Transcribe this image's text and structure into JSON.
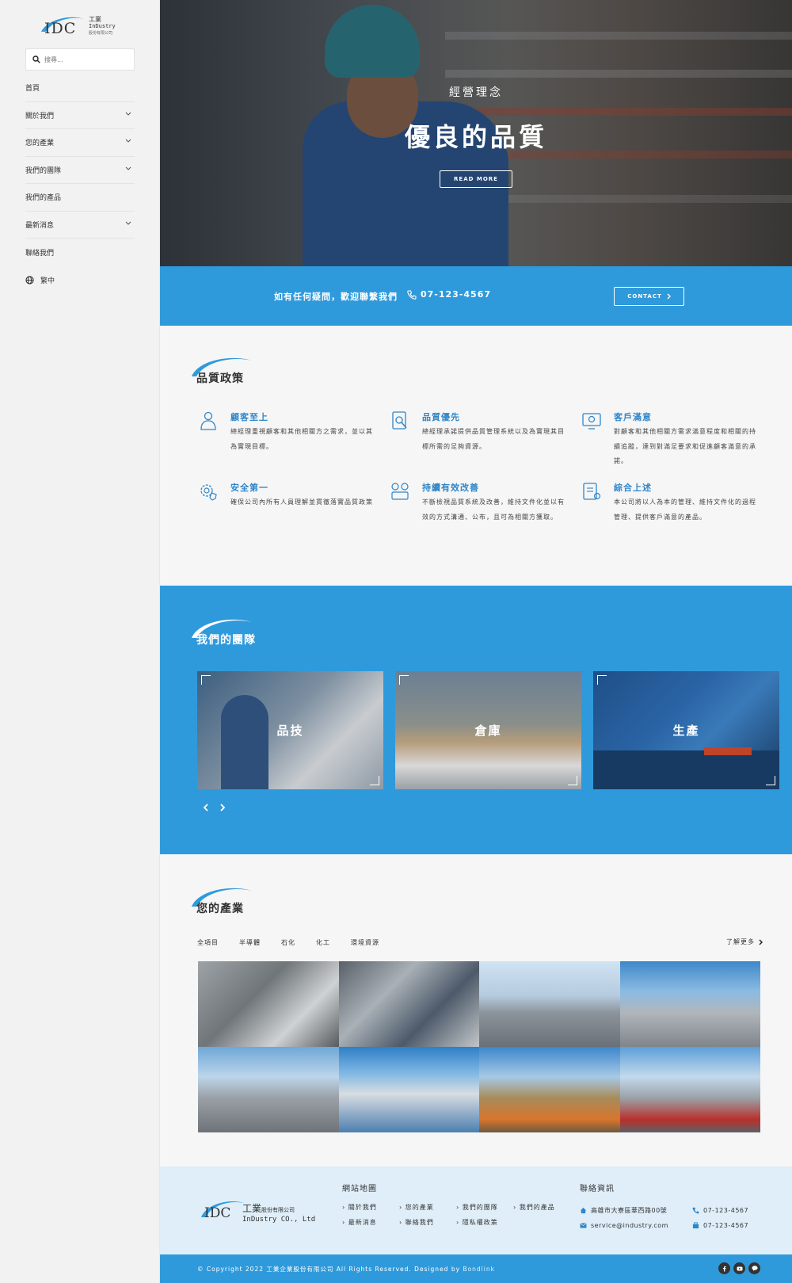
{
  "brand": {
    "logo_text": "IDC",
    "logo_zh": "工業",
    "logo_en": "InDustry",
    "logo_company": "股份有限公司"
  },
  "search": {
    "placeholder": "搜尋..."
  },
  "nav": {
    "items": [
      {
        "label": "首頁",
        "has_submenu": false
      },
      {
        "label": "關於我們",
        "has_submenu": true
      },
      {
        "label": "您的產業",
        "has_submenu": true
      },
      {
        "label": "我們的團隊",
        "has_submenu": true
      },
      {
        "label": "我們的產品",
        "has_submenu": false
      },
      {
        "label": "最新消息",
        "has_submenu": true
      },
      {
        "label": "聯絡我們",
        "has_submenu": false
      }
    ],
    "language": "繁中"
  },
  "hero": {
    "subtitle": "經營理念",
    "title": "優良的品質",
    "button": "READ MORE"
  },
  "contact_bar": {
    "text": "如有任何疑問，歡迎聯繫我們",
    "phone": "07-123-4567",
    "button": "CONTACT"
  },
  "quality": {
    "title": "品質政策",
    "items": [
      {
        "icon": "customer-icon",
        "title": "顧客至上",
        "desc": "總經理重視顧客和其他相關方之需求，並以其為實現目標。"
      },
      {
        "icon": "quality-icon",
        "title": "品質優先",
        "desc": "總經理承諾提供品質管理系統以及為實現其目標所需的足夠資源。"
      },
      {
        "icon": "satisfaction-icon",
        "title": "客戶滿意",
        "desc": "對顧客和其他相關方需求滿意程度和相關的持續追蹤，達到對滿足要求和促進顧客滿意的承諾。"
      },
      {
        "icon": "safety-gear-icon",
        "title": "安全第一",
        "desc": "確保公司內所有人員理解並貫徹落實品質政策"
      },
      {
        "icon": "improve-icon",
        "title": "持續有效改善",
        "desc": "不斷檢視品質系統及改善，維持文件化並以有效的方式溝通、公布，且可為相關方獲取。"
      },
      {
        "icon": "summary-icon",
        "title": "綜合上述",
        "desc": "本公司將以人為本的管理、維持文件化的過程管理、提供客戶滿意的產品。"
      }
    ]
  },
  "team": {
    "title": "我們的團隊",
    "cards": [
      {
        "label": "品技"
      },
      {
        "label": "倉庫"
      },
      {
        "label": "生產"
      }
    ]
  },
  "industry": {
    "title": "您的產業",
    "filters": [
      "全項目",
      "半導體",
      "石化",
      "化工",
      "環境資源"
    ],
    "more": "了解更多"
  },
  "footer": {
    "logo_zh": "工業",
    "logo_zh_small": "股份有限公司",
    "logo_en": "InDustry CO., Ltd",
    "sitemap_title": "網站地圖",
    "sitemap": [
      "關於我們",
      "您的產業",
      "我們的團隊",
      "我們的產品",
      "最新消息",
      "聯絡我們",
      "隱私權政策"
    ],
    "contact_title": "聯絡資訊",
    "address": "高雄市大寮區華西路00號",
    "email": "service@industry.com",
    "phone": "07-123-4567",
    "fax": "07-123-4567",
    "copyright": "© Copyright 2022 工業企業股份有限公司 All Rights Reserved. Designed by",
    "designer": "Bondlink"
  },
  "colors": {
    "accent": "#2f9adb",
    "heading_blue": "#2f86c8"
  }
}
